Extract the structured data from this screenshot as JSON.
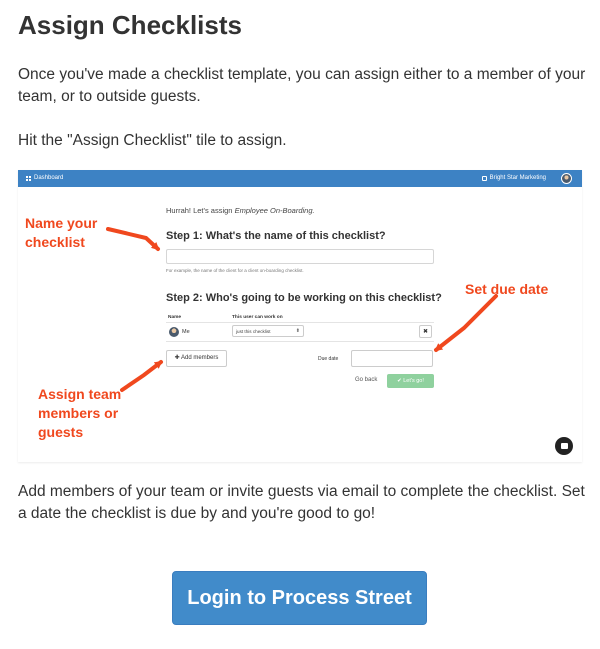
{
  "article": {
    "title": "Assign Checklists",
    "intro": "Once you've made a checklist template, you can assign either to a member of your team, or to outside guests.",
    "hint": "Hit the \"Assign Checklist\" tile to assign.",
    "outro": "Add members of your team or invite guests via email to complete the checklist. Set a date the checklist is due by and you're good to go!",
    "cta_label": "Login to Process Street"
  },
  "screenshot": {
    "navbar": {
      "dashboard_label": "Dashboard",
      "org_name": "Bright Star Marketing",
      "color": "#3d82c4"
    },
    "hurrah_prefix": "Hurrah! Let's assign ",
    "hurrah_template": "Employee On-Boarding.",
    "step1_heading": "Step 1: What's the name of this checklist?",
    "name_help": "For example, the name of the client for a client on-boarding checklist.",
    "step2_heading": "Step 2: Who's going to be working on this checklist?",
    "table": {
      "col_name": "Name",
      "col_work": "This user can work on",
      "rows": [
        {
          "name": "Me",
          "permission": "just this checklist",
          "remove": "✖"
        }
      ]
    },
    "add_members_label": "Add members",
    "due_date_label": "Due date",
    "go_back_label": "Go back",
    "lets_go_label": "✔ Let's go!",
    "lets_go_color": "#8fd19e"
  },
  "annotations": {
    "name": [
      "Name your",
      "checklist"
    ],
    "due": [
      "Set due date"
    ],
    "assign": [
      "Assign team",
      "members or",
      "guests"
    ],
    "color": "#f0481e"
  },
  "colors": {
    "cta": "#418bca",
    "text": "#333333"
  }
}
